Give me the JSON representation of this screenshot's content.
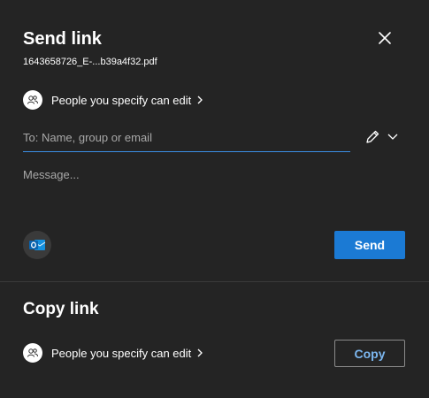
{
  "send_link": {
    "title": "Send link",
    "filename": "1643658726_E-...b39a4f32.pdf",
    "permission": "People you specify can edit",
    "to_placeholder": "To: Name, group or email",
    "to_value": "",
    "message_placeholder": "Message...",
    "send_label": "Send"
  },
  "copy_link": {
    "title": "Copy link",
    "permission": "People you specify can edit",
    "copy_label": "Copy"
  },
  "icons": {
    "close": "close-icon",
    "people": "people-icon",
    "chevron_right": "chevron-right-icon",
    "pencil": "pencil-icon",
    "chevron_down": "chevron-down-icon",
    "outlook": "outlook-icon"
  },
  "colors": {
    "background": "#242424",
    "accent": "#1b7ad4",
    "focus_underline": "#3b8fe6",
    "copy_text": "#7cb7f0",
    "placeholder": "#a8a8a8"
  }
}
